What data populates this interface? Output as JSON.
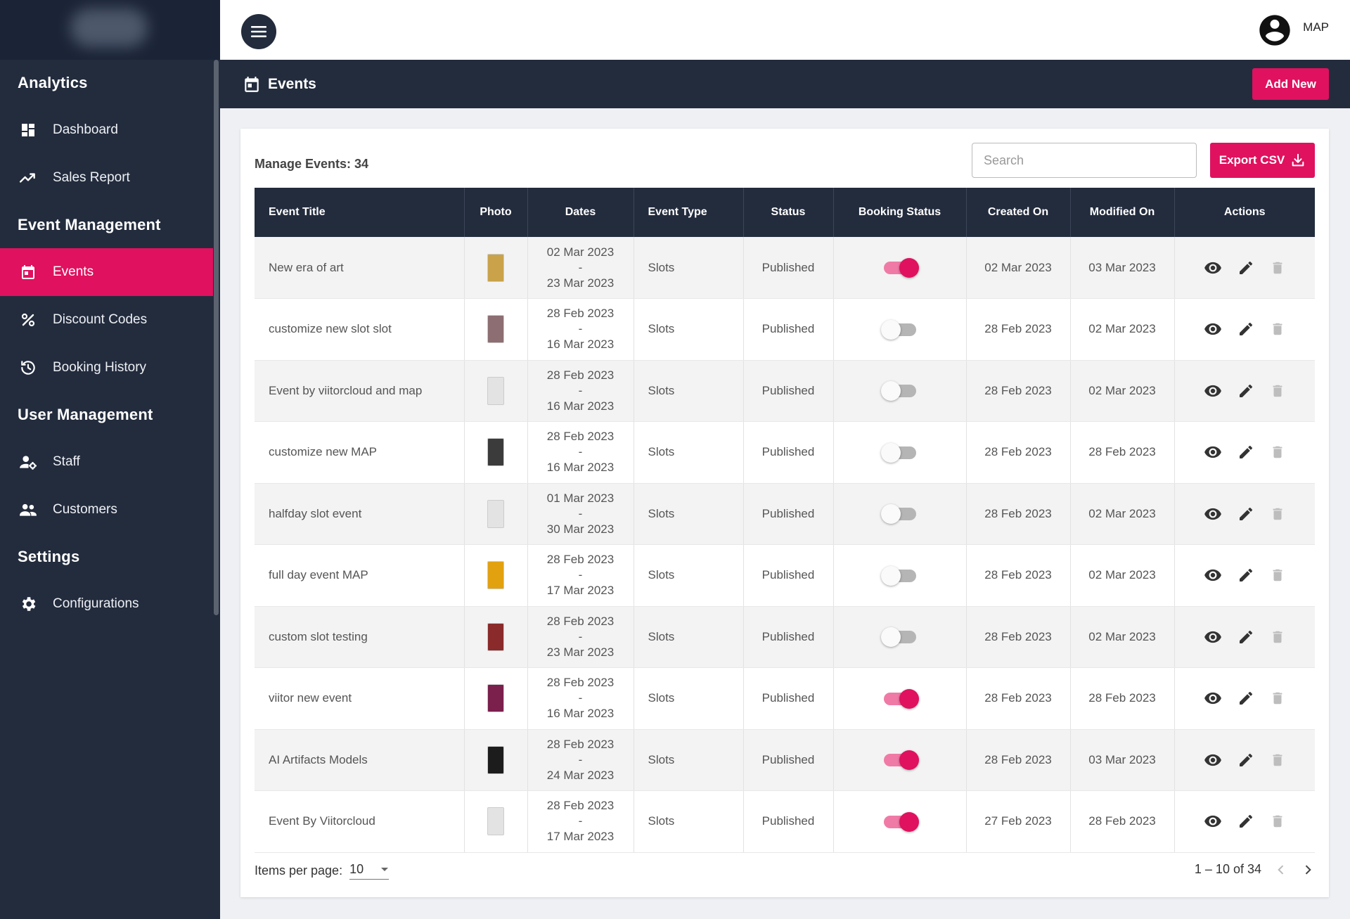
{
  "header": {
    "user_label": "MAP"
  },
  "sidebar": {
    "sections": [
      {
        "title": "Analytics",
        "items": [
          {
            "label": "Dashboard",
            "icon": "dashboard-icon"
          },
          {
            "label": "Sales Report",
            "icon": "trending-up-icon"
          }
        ]
      },
      {
        "title": "Event Management",
        "items": [
          {
            "label": "Events",
            "icon": "calendar-icon",
            "active": true
          },
          {
            "label": "Discount Codes",
            "icon": "percent-icon"
          },
          {
            "label": "Booking History",
            "icon": "history-icon"
          }
        ]
      },
      {
        "title": "User Management",
        "items": [
          {
            "label": "Staff",
            "icon": "staff-icon"
          },
          {
            "label": "Customers",
            "icon": "customers-icon"
          }
        ]
      },
      {
        "title": "Settings",
        "items": [
          {
            "label": "Configurations",
            "icon": "settings-icon"
          }
        ]
      }
    ]
  },
  "page": {
    "title": "Events",
    "add_new_label": "Add New"
  },
  "card": {
    "manage_label": "Manage Events: 34",
    "search_placeholder": "Search",
    "export_label": "Export CSV"
  },
  "table": {
    "columns": [
      "Event Title",
      "Photo",
      "Dates",
      "Event Type",
      "Status",
      "Booking Status",
      "Created On",
      "Modified On",
      "Actions"
    ],
    "rows": [
      {
        "title": "New era of art",
        "start": "02 Mar 2023",
        "end": "23 Mar 2023",
        "type": "Slots",
        "status": "Published",
        "booking": true,
        "created": "02 Mar 2023",
        "modified": "03 Mar 2023",
        "thumb": "#c9a24a"
      },
      {
        "title": "customize new slot slot",
        "start": "28 Feb 2023",
        "end": "16 Mar 2023",
        "type": "Slots",
        "status": "Published",
        "booking": false,
        "created": "28 Feb 2023",
        "modified": "02 Mar 2023",
        "thumb": "#8d6e72"
      },
      {
        "title": "Event by viitorcloud and map",
        "start": "28 Feb 2023",
        "end": "16 Mar 2023",
        "type": "Slots",
        "status": "Published",
        "booking": false,
        "created": "28 Feb 2023",
        "modified": "02 Mar 2023",
        "thumb": "#e3e3e3"
      },
      {
        "title": "customize new MAP",
        "start": "28 Feb 2023",
        "end": "16 Mar 2023",
        "type": "Slots",
        "status": "Published",
        "booking": false,
        "created": "28 Feb 2023",
        "modified": "28 Feb 2023",
        "thumb": "#3b3b3b"
      },
      {
        "title": "halfday slot event",
        "start": "01 Mar 2023",
        "end": "30 Mar 2023",
        "type": "Slots",
        "status": "Published",
        "booking": false,
        "created": "28 Feb 2023",
        "modified": "02 Mar 2023",
        "thumb": "#e3e3e3"
      },
      {
        "title": "full day event MAP",
        "start": "28 Feb 2023",
        "end": "17 Mar 2023",
        "type": "Slots",
        "status": "Published",
        "booking": false,
        "created": "28 Feb 2023",
        "modified": "02 Mar 2023",
        "thumb": "#e2a10f"
      },
      {
        "title": "custom slot testing",
        "start": "28 Feb 2023",
        "end": "23 Mar 2023",
        "type": "Slots",
        "status": "Published",
        "booking": false,
        "created": "28 Feb 2023",
        "modified": "02 Mar 2023",
        "thumb": "#8a2a2a"
      },
      {
        "title": "viitor new event",
        "start": "28 Feb 2023",
        "end": "16 Mar 2023",
        "type": "Slots",
        "status": "Published",
        "booking": true,
        "created": "28 Feb 2023",
        "modified": "28 Feb 2023",
        "thumb": "#7b1f4d"
      },
      {
        "title": "AI Artifacts Models",
        "start": "28 Feb 2023",
        "end": "24 Mar 2023",
        "type": "Slots",
        "status": "Published",
        "booking": true,
        "created": "28 Feb 2023",
        "modified": "03 Mar 2023",
        "thumb": "#1c1c1c"
      },
      {
        "title": "Event By Viitorcloud",
        "start": "28 Feb 2023",
        "end": "17 Mar 2023",
        "type": "Slots",
        "status": "Published",
        "booking": true,
        "created": "27 Feb 2023",
        "modified": "28 Feb 2023",
        "thumb": "#e3e3e3"
      }
    ],
    "date_separator": "-"
  },
  "footer": {
    "items_per_page_label": "Items per page:",
    "items_per_page_value": "10",
    "range_label": "1 – 10 of 34"
  },
  "colors": {
    "accent": "#e0115f",
    "dark": "#232c3d"
  }
}
